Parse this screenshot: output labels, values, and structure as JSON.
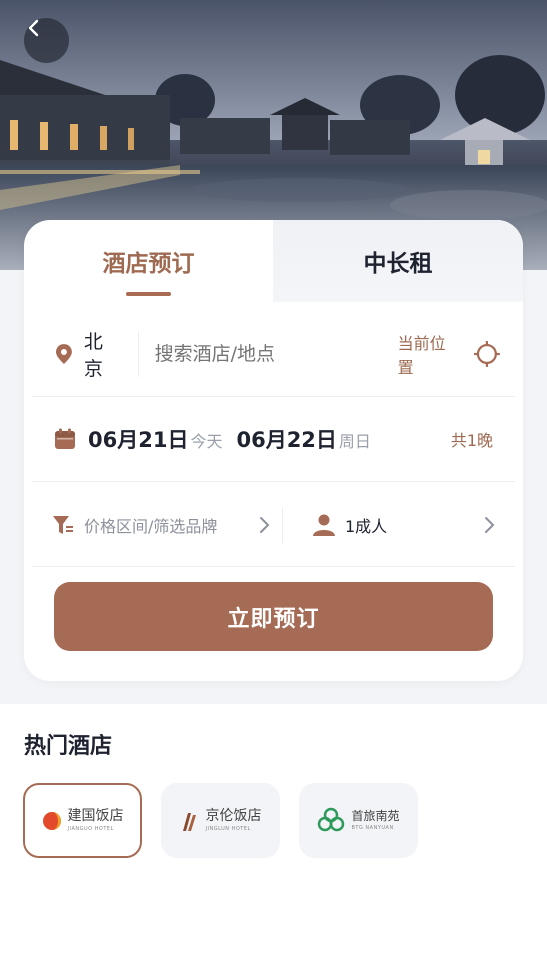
{
  "icons": {
    "back": "chevron-left-icon",
    "location_pin": "location-pin-icon",
    "crosshair": "crosshair-icon",
    "calendar": "calendar-icon",
    "filter": "filter-icon",
    "person": "person-icon",
    "chevron": "chevron-right-icon"
  },
  "colors": {
    "accent": "#a66b54",
    "accent_text": "#9f6a52",
    "muted": "#9aa0ab",
    "panel_bg": "#f3f4f7"
  },
  "tabs": [
    {
      "label": "酒店预订",
      "active": true
    },
    {
      "label": "中长租",
      "active": false
    }
  ],
  "search": {
    "city": "北京",
    "placeholder": "搜索酒店/地点",
    "current_location_label": "当前位置"
  },
  "dates": {
    "checkin": "06月21日",
    "checkin_weekday": "今天",
    "checkout": "06月22日",
    "checkout_weekday": "周日",
    "nights": "共1晚"
  },
  "filters": {
    "price_brand_label": "价格区间/筛选品牌",
    "guests_label": "1成人"
  },
  "book_button": "立即预订",
  "popular": {
    "title": "热门酒店",
    "brands": [
      {
        "name": "建国饭店",
        "sub": "JIANGUO HOTEL",
        "active": true
      },
      {
        "name": "京伦饭店",
        "sub": "JINGLUN HOTEL",
        "active": false
      },
      {
        "name": "首旅南苑",
        "sub": "BTG NANYUAN",
        "active": false
      }
    ]
  }
}
